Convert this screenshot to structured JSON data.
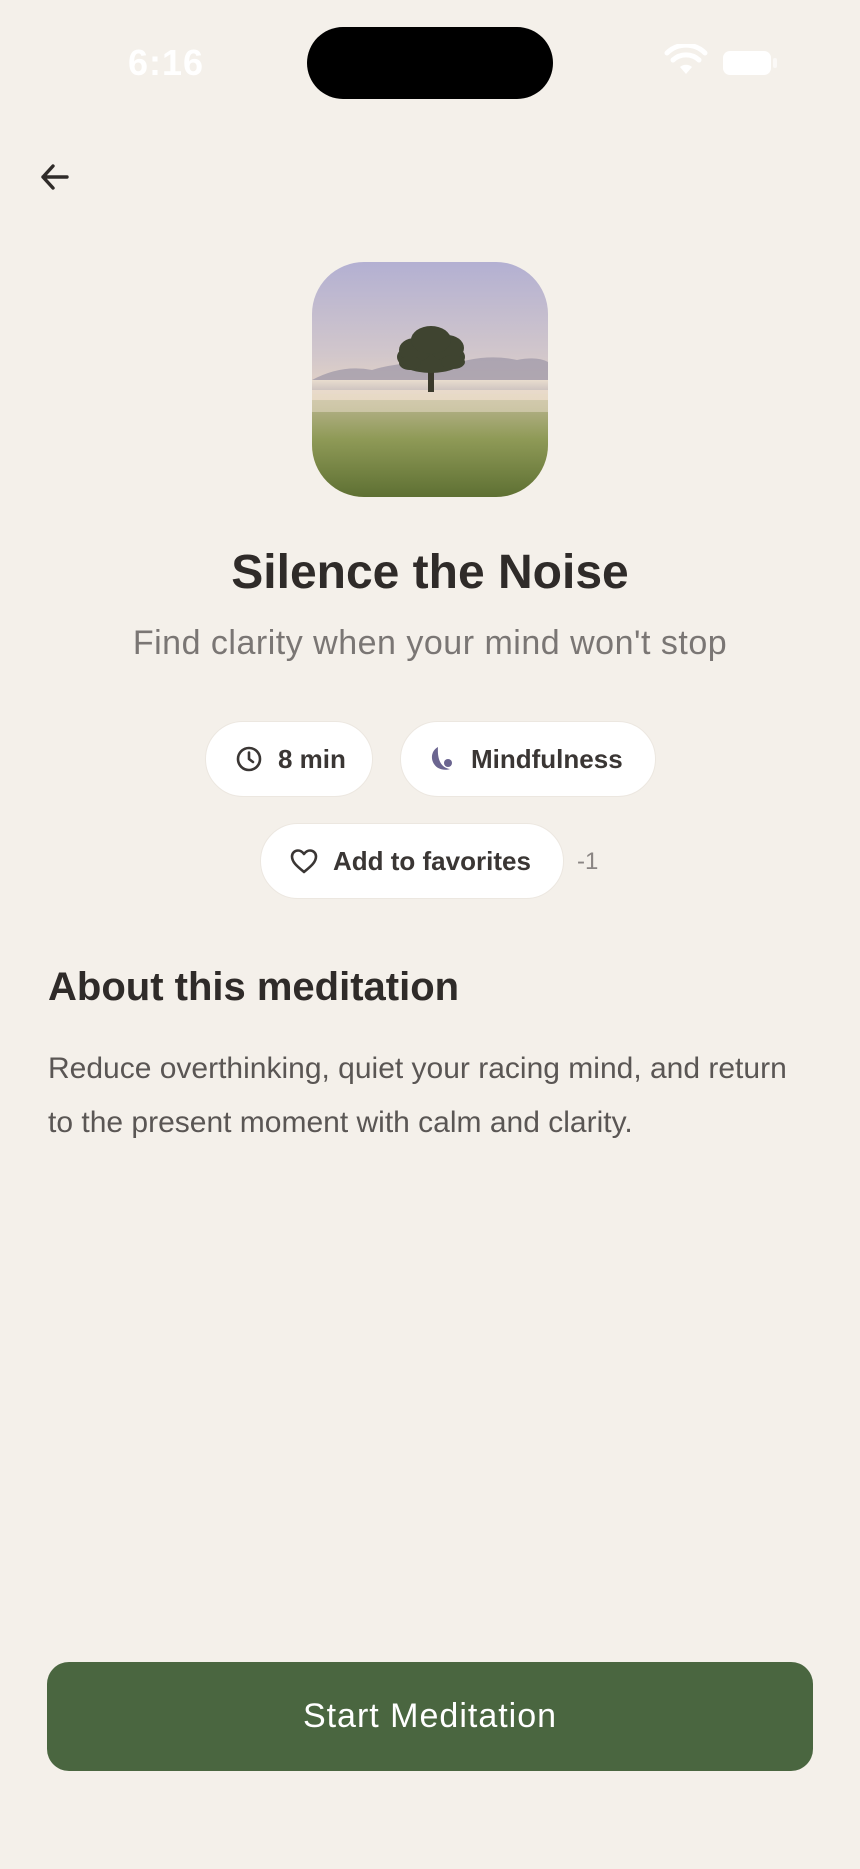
{
  "status_bar": {
    "time": "6:16",
    "wifi_icon": "wifi-icon",
    "battery_icon": "battery-icon"
  },
  "nav": {
    "back_icon": "arrow-left-icon"
  },
  "meditation": {
    "cover_image": "misty-field-tree-image",
    "title": "Silence the Noise",
    "subtitle": "Find clarity when your mind won't stop",
    "duration": "8 min",
    "duration_icon": "clock-icon",
    "category": "Mindfulness",
    "category_icon": "moon-icon",
    "favorite_label": "Add to favorites",
    "favorite_icon": "heart-icon",
    "favorite_count": "-1"
  },
  "about": {
    "heading": "About this meditation",
    "description": "Reduce overthinking, quiet your racing mind, and return to the present moment with calm and clarity."
  },
  "actions": {
    "start_label": "Start Meditation"
  },
  "colors": {
    "background": "#f4f0ea",
    "primary_button": "#4a6640",
    "chip_background": "#ffffff",
    "category_icon": "#6b6590"
  }
}
